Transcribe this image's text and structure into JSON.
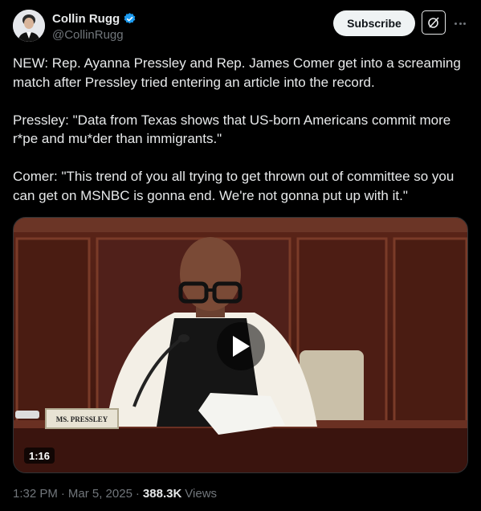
{
  "author": {
    "name": "Collin Rugg",
    "handle": "@CollinRugg"
  },
  "actions": {
    "subscribe_label": "Subscribe"
  },
  "tweet": {
    "text": "NEW: Rep. Ayanna Pressley and Rep. James Comer get into a screaming match after Pressley tried entering an article into the record.\n\nPressley: \"Data from Texas shows that US-born Americans commit more r*pe and mu*der than immigrants.\"\n\nComer: \"This trend of you all trying to get thrown out of committee so you can get on MSNBC is gonna end. We're not gonna put up with it.\""
  },
  "video": {
    "duration": "1:16",
    "nameplate": "MS. PRESSLEY"
  },
  "meta": {
    "time": "1:32 PM",
    "date": "Mar 5, 2025",
    "views_count": "388.3K",
    "views_label": "Views"
  },
  "colors": {
    "background": "#000000",
    "text": "#e7e9ea",
    "muted": "#71767b",
    "verified": "#1d9bf0"
  }
}
